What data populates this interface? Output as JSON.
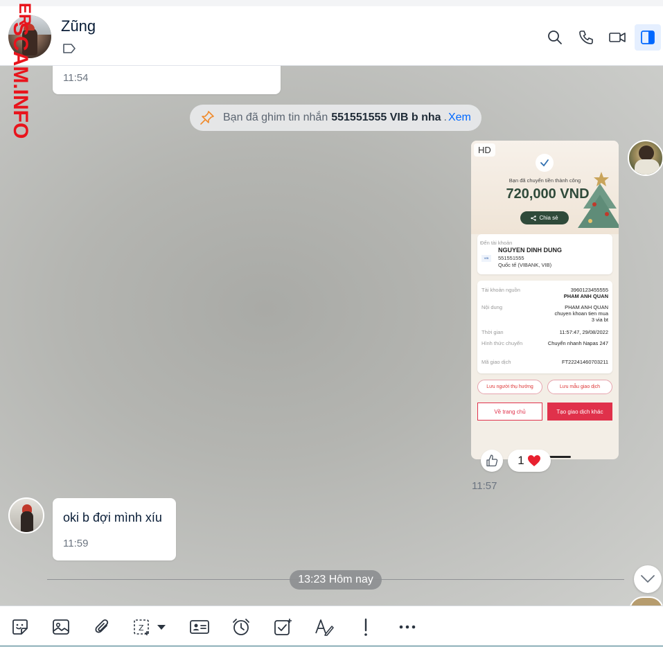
{
  "watermark": {
    "line1": "ER",
    "line2": "SCAM.INFO"
  },
  "header": {
    "contact_name": "Zũng"
  },
  "messages": {
    "first_time": "11:54",
    "pinned": {
      "prefix": "Bạn đã ghim tin nhắn",
      "content": "551551555 VIB b nha",
      "separator": ".",
      "link": "Xem"
    },
    "image_message": {
      "badge": "HD",
      "time": "11:57",
      "reaction_count": "1",
      "receipt": {
        "success_text": "Bạn đã chuyển tiền thành công",
        "amount": "720,000 VND",
        "share_label": "Chia sẻ",
        "to_label": "Đến tài khoản",
        "recipient_name": "NGUYEN DINH DUNG",
        "recipient_account": "551551555",
        "recipient_bank": "Quốc tế (VIBANK, VIB)",
        "bank_logo": "VIB",
        "rows": [
          {
            "k": "Tài khoản nguồn",
            "v": "3960123455555",
            "v2": "PHAM ANH QUAN"
          },
          {
            "k": "Nội dung",
            "v": "PHAM ANH QUAN chuyen khoan tien mua 3 via bt",
            "v2": ""
          },
          {
            "k": "Thời gian",
            "v": "11:57:47, 29/08/2022",
            "v2": ""
          },
          {
            "k": "Hình thức chuyển",
            "v": "Chuyển nhanh Napas 247",
            "v2": ""
          },
          {
            "k": "Mã giao dịch",
            "v": "FT22241460703211",
            "v2": ""
          }
        ],
        "save_recipient": "Lưu người thụ hưởng",
        "save_template": "Lưu mẫu giao dịch",
        "home": "Về trang chủ",
        "new_transaction": "Tạo giao dịch khác"
      }
    },
    "incoming": {
      "text": "oki b đợi mình xíu",
      "time": "11:59"
    },
    "date_divider": "13:23 Hôm nay"
  },
  "colors": {
    "accent": "#0068ff",
    "watermark": "#e8141c",
    "brand_red": "#e0314b",
    "receipt_green": "#2f4a3a"
  },
  "toolbar_icons": [
    "sticker-icon",
    "image-icon",
    "attachment-icon",
    "screenshot-icon",
    "contact-card-icon",
    "reminder-icon",
    "task-icon",
    "text-format-icon",
    "urgent-icon",
    "more-icon"
  ]
}
